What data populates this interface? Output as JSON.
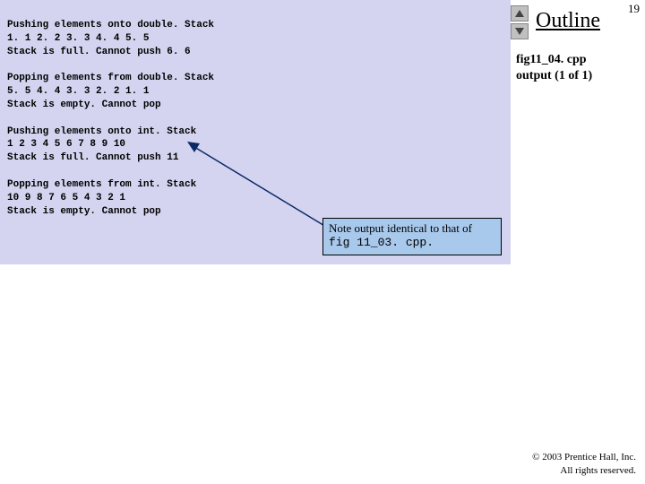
{
  "pageNumber": "19",
  "outlineTitle": "Outline",
  "fileInfo": {
    "name": "fig11_04. cpp",
    "subtitle": "output (1 of 1)"
  },
  "code": {
    "block1": "Pushing elements onto double. Stack\n1. 1 2. 2 3. 3 4. 4 5. 5\nStack is full. Cannot push 6. 6",
    "block2": "Popping elements from double. Stack\n5. 5 4. 4 3. 3 2. 2 1. 1\nStack is empty. Cannot pop",
    "block3": "Pushing elements onto int. Stack\n1 2 3 4 5 6 7 8 9 10\nStack is full. Cannot push 11",
    "block4": "Popping elements from int. Stack\n10 9 8 7 6 5 4 3 2 1\nStack is empty. Cannot pop"
  },
  "callout": {
    "line1": "Note output identical to that of",
    "line2": "fig 11_03. cpp."
  },
  "copyright": {
    "line1": "© 2003 Prentice Hall, Inc.",
    "line2": "All rights reserved."
  },
  "icons": {
    "up": "up-triangle",
    "down": "down-triangle"
  }
}
